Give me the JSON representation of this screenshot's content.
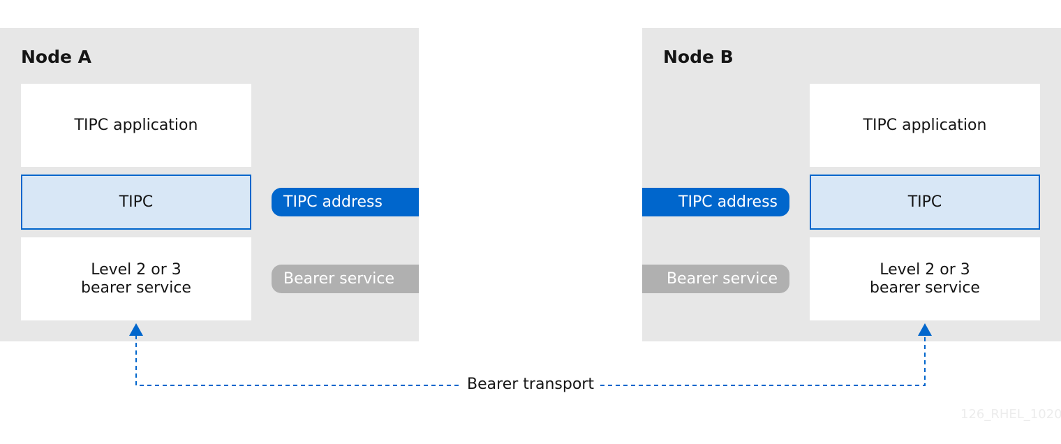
{
  "nodes": [
    {
      "title": "Node A",
      "layers": {
        "application": "TIPC application",
        "tipc": "TIPC",
        "bearer_line1": "Level 2 or 3",
        "bearer_line2": "bearer service"
      },
      "labels": {
        "address": "TIPC address",
        "bearer": "Bearer service"
      }
    },
    {
      "title": "Node B",
      "layers": {
        "application": "TIPC application",
        "tipc": "TIPC",
        "bearer_line1": "Level 2 or 3",
        "bearer_line2": "bearer service"
      },
      "labels": {
        "address": "TIPC address",
        "bearer": "Bearer service"
      }
    }
  ],
  "connection": {
    "label": "Bearer transport",
    "style": "dashed",
    "color": "#0066cc"
  },
  "colors": {
    "accent": "#0066cc",
    "tipc_fill": "#d8e7f6",
    "bearer_pill": "#b0b0b0",
    "node_bg": "#e7e7e7"
  },
  "watermark": "126_RHEL_1020"
}
